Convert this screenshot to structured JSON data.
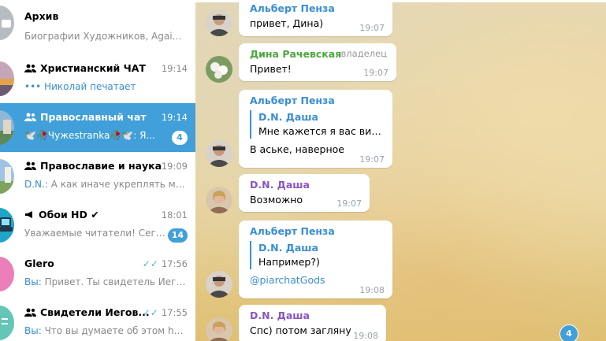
{
  "sidebar": {
    "chats": [
      {
        "title": "Архив",
        "preview": "Биографии Художников, Againo...",
        "time": "",
        "badge": ""
      },
      {
        "title": "Христианский ЧАТ",
        "time": "19:14",
        "preview": "Николай печатает",
        "badge": ""
      },
      {
        "title": "Православный чат",
        "time": "19:14",
        "preview_prefix": "🕊️🥀Чужеstranka🥀🕊️: Я...",
        "badge": "4"
      },
      {
        "title": "Православие и наука",
        "time": "19:09",
        "preview_sender": "D.N.:",
        "preview": "А как иначе укреплять мы...",
        "badge": ""
      },
      {
        "title": "Обои HD ✔",
        "time": "18:01",
        "preview": "Уважаемые читатели! Сего...",
        "badge": "14"
      },
      {
        "title": "Glero",
        "time": "17:56",
        "preview_sender": "Вы:",
        "preview": "Привет. Ты свидетель Иегов...",
        "badge": ""
      },
      {
        "title": "Свидетели Иегов...",
        "time": "17:55",
        "preview_sender": "Вы:",
        "preview": "Что вы думаете об этом htt...",
        "badge": ""
      }
    ]
  },
  "messages": [
    {
      "sender": "Альберт Пенза",
      "text": "привет, Дина)",
      "time": "19:07"
    },
    {
      "sender": "Дина Рачевская",
      "role": "владелец",
      "text": "Привет!",
      "time": "19:07"
    },
    {
      "sender": "Альберт Пенза",
      "reply_name": "D.N. Даша",
      "reply_text": "Мне кажется я вас виде...",
      "text": "В аське, наверное",
      "time": "19:07"
    },
    {
      "sender": "D.N. Даша",
      "text": "Возможно",
      "time": "19:07"
    },
    {
      "sender": "Альберт Пенза",
      "reply_name": "D.N. Даша",
      "reply_text": "Например?)",
      "text": "@piarchatGods",
      "time": "19:08"
    },
    {
      "sender": "D.N. Даша",
      "text": "Спс) потом загляну",
      "time": "19:08"
    }
  ],
  "unread_fab": "4",
  "colors": {
    "accent": "#419fd9",
    "link": "#3a8ed3",
    "owner_name": "#4aa83b",
    "dasha_name": "#8a55c4"
  }
}
